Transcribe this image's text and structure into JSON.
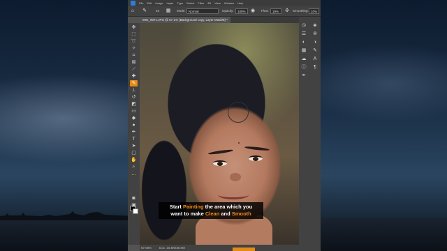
{
  "app": {
    "menu": [
      "File",
      "Edit",
      "Image",
      "Layer",
      "Type",
      "Select",
      "Filter",
      "3D",
      "View",
      "Window",
      "Help"
    ]
  },
  "options_bar": {
    "brush_size": "45",
    "mode_label": "Mode:",
    "mode_value": "Normal",
    "opacity_label": "Opacity:",
    "opacity_value": "100%",
    "flow_label": "Flow:",
    "flow_value": "19%",
    "smoothing_label": "Smoothing:",
    "smoothing_value": "10%"
  },
  "document_tab": {
    "title": "IMG_9071.JPG @ 57.1% (Background copy, Layer Mask/8) *"
  },
  "caption": {
    "w1": "Start ",
    "w2": "Painting",
    "w3": " the area which you",
    "line2a": "want to make ",
    "w4": "Clean",
    "w5": " and ",
    "w6": "Smooth"
  },
  "status_bar": {
    "zoom": "57.06%",
    "doc_size": "Doc: 18.0M/36.0M"
  },
  "colors": {
    "accent": "#e38b16",
    "caption_highlight": "#f28a1c"
  },
  "icons": {
    "active_tool": "brush-tool-icon"
  }
}
